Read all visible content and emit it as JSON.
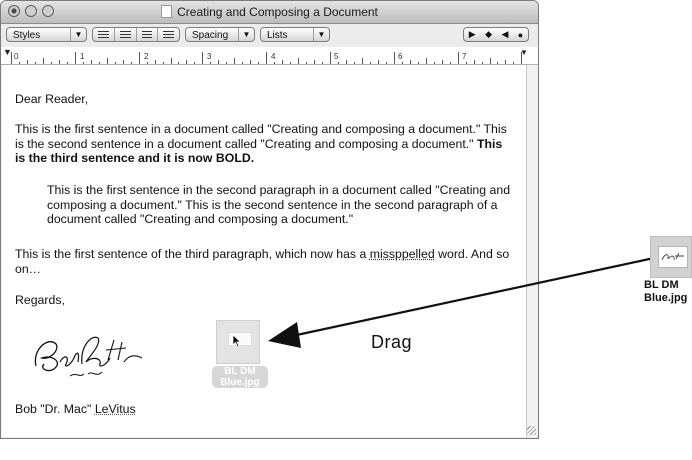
{
  "window": {
    "title": "Creating and Composing a Document"
  },
  "toolbar": {
    "styles_label": "Styles",
    "spacing_label": "Spacing",
    "lists_label": "Lists",
    "nav_glyphs": [
      "▶",
      "◆",
      "◀",
      "●"
    ]
  },
  "ruler": {
    "numbers": [
      "0",
      "1",
      "2",
      "3",
      "4",
      "5",
      "6",
      "7"
    ]
  },
  "document": {
    "greeting": "Dear Reader,",
    "p1_text": "This is the first sentence in a document called \"Creating and composing a document.\" This is the second sentence in a document called \"Creating and composing a document.\" ",
    "p1_bold": "This is the third sentence and it is now BOLD.",
    "p2_text": "This is the first sentence in the second paragraph in a document called \"Creating and composing a document.\" This is the second sentence in the second paragraph of a document called \"Creating and composing a document.\"",
    "p3_before": " This is the first sentence of the third paragraph, which now has a ",
    "p3_misspelled": "missppelled",
    "p3_after": " word. And so on…",
    "closing": "Regards,",
    "sig_before": "Bob \"Dr. Mac\" ",
    "sig_name": "LeVitus"
  },
  "drag": {
    "label": "Drag",
    "ghost_label": "BL DM Blue.jpg"
  },
  "desktop_file": {
    "label_line1": "BL DM",
    "label_line2": "Blue.jpg"
  },
  "colors": {
    "misspell_underline": "#c00000",
    "arrow": "#111111"
  }
}
